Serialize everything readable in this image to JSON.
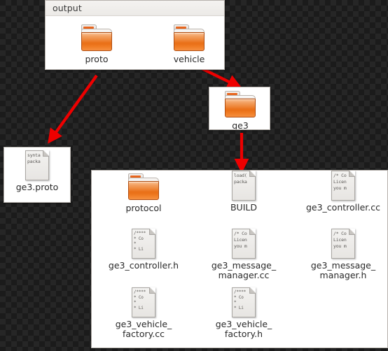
{
  "theme": {
    "background_pattern": "transparency-checkerboard",
    "background_dark": "#1b1b1b",
    "background_light": "#262626",
    "panel_background": "#ffffff",
    "arrow_color": "#ee0000",
    "folder_color": "#ec7a25",
    "label_color": "#2a2a2a"
  },
  "panels": {
    "output": {
      "title": "output",
      "items": [
        {
          "name": "proto",
          "label": "proto",
          "icon": "folder-icon"
        },
        {
          "name": "vehicle",
          "label": "vehicle",
          "icon": "folder-icon"
        }
      ]
    },
    "ge3": {
      "title": "",
      "items": [
        {
          "name": "ge3",
          "label": "ge3",
          "icon": "folder-icon"
        }
      ]
    },
    "proto_contents": {
      "title": "",
      "items": [
        {
          "name": "ge3-proto",
          "label": "ge3.proto",
          "icon": "text-file-icon",
          "preview": [
            "synta",
            "packa"
          ]
        }
      ]
    },
    "ge3_contents": {
      "title": "",
      "items": [
        {
          "name": "protocol",
          "label": "protocol",
          "icon": "folder-icon",
          "preview": []
        },
        {
          "name": "build",
          "label": "BUILD",
          "icon": "text-file-icon",
          "preview": [
            "load(",
            "packa"
          ]
        },
        {
          "name": "ge3-controller-cc",
          "label": "ge3_controller.cc",
          "icon": "text-file-icon",
          "preview": [
            "/* Co",
            "Licen",
            "you m"
          ]
        },
        {
          "name": "ge3-controller-h",
          "label": "ge3_controller.h",
          "icon": "text-file-icon",
          "preview": [
            "/****",
            " * Co",
            " *",
            " * Li"
          ]
        },
        {
          "name": "ge3-message-manager-cc",
          "label": "ge3_message_\nmanager.cc",
          "icon": "text-file-icon",
          "preview": [
            "/* Co",
            "Licen",
            "you m"
          ]
        },
        {
          "name": "ge3-message-manager-h",
          "label": "ge3_message_\nmanager.h",
          "icon": "text-file-icon",
          "preview": [
            "/* Co",
            "Licen",
            "you m"
          ]
        },
        {
          "name": "ge3-vehicle-factory-cc",
          "label": "ge3_vehicle_\nfactory.cc",
          "icon": "text-file-icon",
          "preview": [
            "/****",
            " * Co",
            " *",
            " * Li"
          ]
        },
        {
          "name": "ge3-vehicle-factory-h",
          "label": "ge3_vehicle_\nfactory.h",
          "icon": "text-file-icon",
          "preview": [
            "/****",
            " * Co",
            " *",
            " * Li"
          ]
        }
      ]
    }
  },
  "arrows": [
    {
      "name": "arrow-proto-to-ge3proto",
      "from": "proto",
      "to": "ge3.proto"
    },
    {
      "name": "arrow-vehicle-to-ge3",
      "from": "vehicle",
      "to": "ge3"
    },
    {
      "name": "arrow-ge3-to-contents",
      "from": "ge3",
      "to": "ge3 contents"
    }
  ]
}
